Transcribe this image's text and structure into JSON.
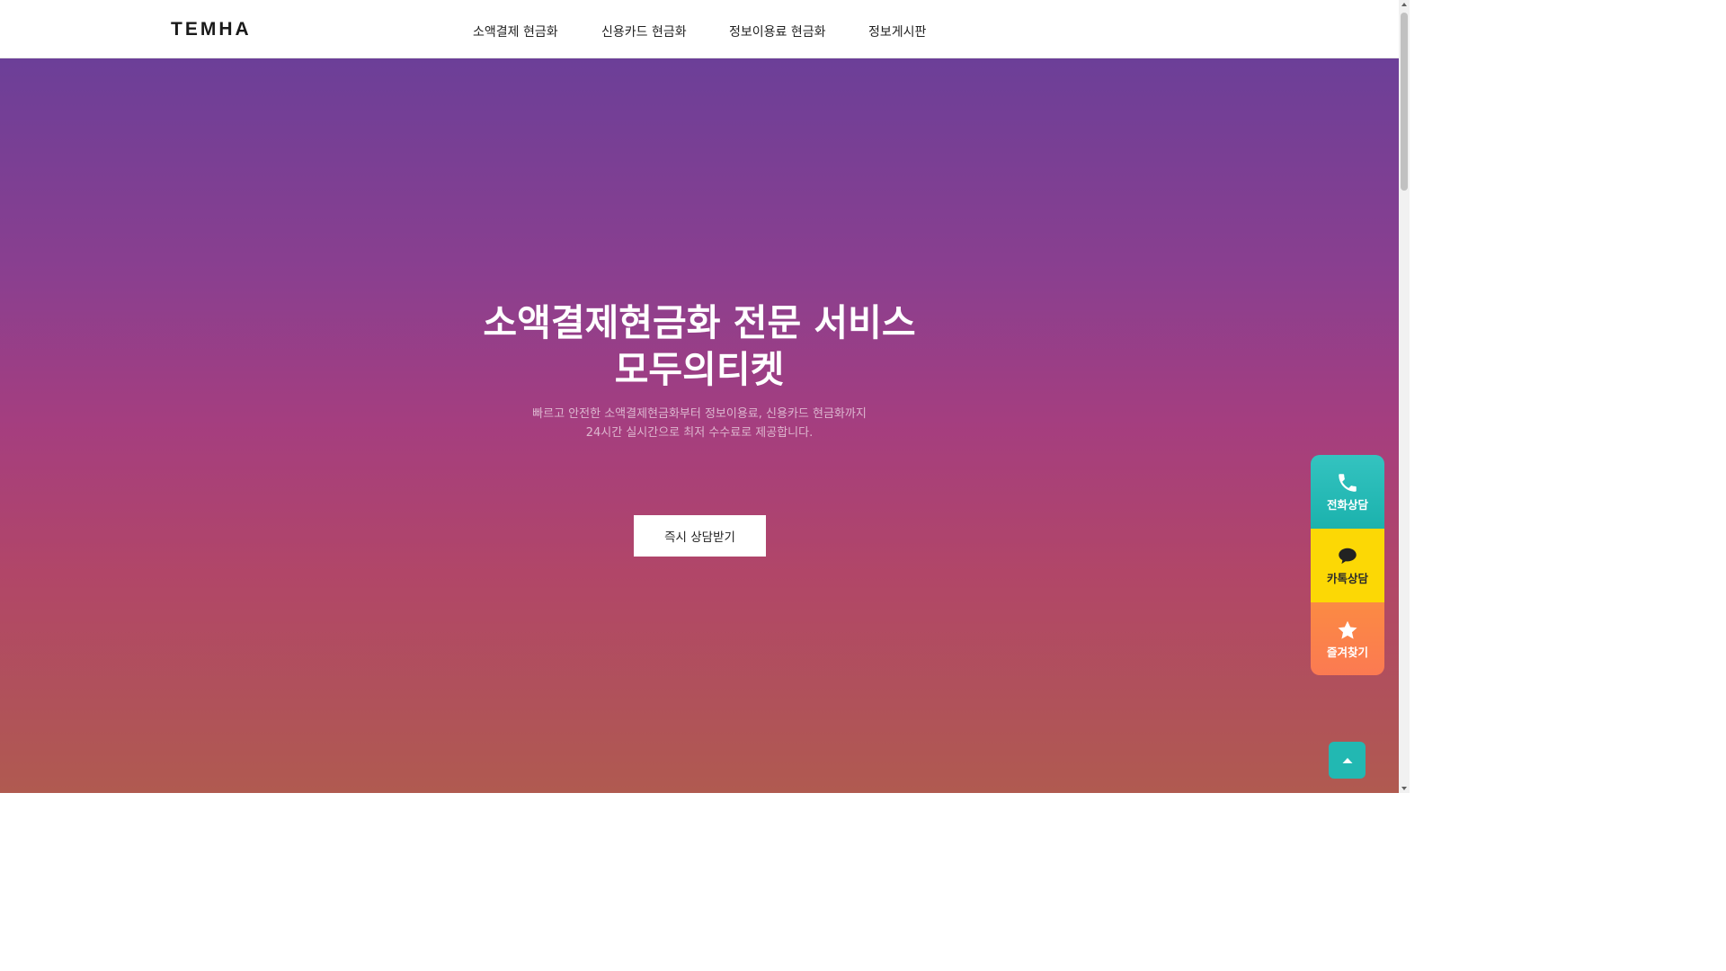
{
  "header": {
    "logo": "TEMHA",
    "nav": [
      {
        "label": "소액결제 현금화"
      },
      {
        "label": "신용카드 현금화"
      },
      {
        "label": "정보이용료 현금화"
      },
      {
        "label": "정보게시판"
      }
    ]
  },
  "hero": {
    "title_line1": "소액결제현금화 전문 서비스",
    "title_line2": "모두의티켓",
    "subtitle_line1": "빠르고 안전한 소액결제현금화부터 정보이용료, 신용카드 현금화까지",
    "subtitle_line2": "24시간 실시간으로 최저 수수료로 제공합니다.",
    "cta_label": "즉시 상담받기"
  },
  "quick_menu": [
    {
      "label": "전화상담",
      "icon": "phone-icon",
      "color": "#1bb2ad"
    },
    {
      "label": "카톡상담",
      "icon": "chat-bubble-icon",
      "color": "#fcd805"
    },
    {
      "label": "즐겨찾기",
      "icon": "star-icon",
      "color": "#fb7a52"
    }
  ],
  "top_button": {
    "icon": "caret-up-icon",
    "color": "#22b8b2"
  },
  "colors": {
    "hero_top": "#6c3f98",
    "hero_bottom": "#b05a50"
  }
}
